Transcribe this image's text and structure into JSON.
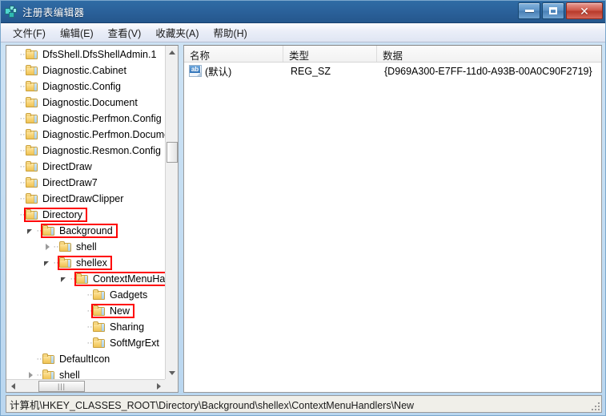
{
  "window": {
    "title": "注册表编辑器",
    "icon": "registry-editor-icon",
    "minimize_label": "最小化",
    "maximize_label": "最大化",
    "close_label": "关闭",
    "close_glyph": "✕"
  },
  "menubar": {
    "items": [
      {
        "label": "文件(F)",
        "name": "menu-file"
      },
      {
        "label": "编辑(E)",
        "name": "menu-edit"
      },
      {
        "label": "查看(V)",
        "name": "menu-view"
      },
      {
        "label": "收藏夹(A)",
        "name": "menu-favorites"
      },
      {
        "label": "帮助(H)",
        "name": "menu-help"
      }
    ]
  },
  "tree": {
    "rows": [
      {
        "label": "DfsShell.DfsShellAdmin.1",
        "indent": 0,
        "twisty": "none",
        "highlight": false
      },
      {
        "label": "Diagnostic.Cabinet",
        "indent": 0,
        "twisty": "none",
        "highlight": false
      },
      {
        "label": "Diagnostic.Config",
        "indent": 0,
        "twisty": "none",
        "highlight": false
      },
      {
        "label": "Diagnostic.Document",
        "indent": 0,
        "twisty": "none",
        "highlight": false
      },
      {
        "label": "Diagnostic.Perfmon.Config",
        "indent": 0,
        "twisty": "none",
        "highlight": false
      },
      {
        "label": "Diagnostic.Perfmon.Documen",
        "indent": 0,
        "twisty": "none",
        "highlight": false
      },
      {
        "label": "Diagnostic.Resmon.Config",
        "indent": 0,
        "twisty": "none",
        "highlight": false
      },
      {
        "label": "DirectDraw",
        "indent": 0,
        "twisty": "none",
        "highlight": false
      },
      {
        "label": "DirectDraw7",
        "indent": 0,
        "twisty": "none",
        "highlight": false
      },
      {
        "label": "DirectDrawClipper",
        "indent": 0,
        "twisty": "none",
        "highlight": false
      },
      {
        "label": "Directory",
        "indent": 0,
        "twisty": "none",
        "highlight": true
      },
      {
        "label": "Background",
        "indent": 1,
        "twisty": "expanded",
        "highlight": true
      },
      {
        "label": "shell",
        "indent": 2,
        "twisty": "collapsed",
        "highlight": false
      },
      {
        "label": "shellex",
        "indent": 2,
        "twisty": "expanded",
        "highlight": true
      },
      {
        "label": "ContextMenuHandlers",
        "indent": 3,
        "twisty": "expanded",
        "highlight": true
      },
      {
        "label": "Gadgets",
        "indent": 4,
        "twisty": "none",
        "highlight": false
      },
      {
        "label": "New",
        "indent": 4,
        "twisty": "none",
        "highlight": true
      },
      {
        "label": "Sharing",
        "indent": 4,
        "twisty": "none",
        "highlight": false
      },
      {
        "label": "SoftMgrExt",
        "indent": 4,
        "twisty": "none",
        "highlight": false
      },
      {
        "label": "DefaultIcon",
        "indent": 1,
        "twisty": "none",
        "highlight": false
      },
      {
        "label": "shell",
        "indent": 1,
        "twisty": "collapsed",
        "highlight": false
      }
    ],
    "scrollbar": {
      "up_arrow": "scroll-up-arrow",
      "down_arrow": "scroll-down-arrow",
      "left_arrow": "scroll-left-arrow",
      "right_arrow": "scroll-right-arrow",
      "h_grip": "|||"
    }
  },
  "list": {
    "columns": [
      "名称",
      "类型",
      "数据"
    ],
    "rows": [
      {
        "icon": "string-value-icon",
        "icon_text": "ab",
        "name": "(默认)",
        "type": "REG_SZ",
        "data": "{D969A300-E7FF-11d0-A93B-00A0C90F2719}"
      }
    ]
  },
  "statusbar": {
    "path": "计算机\\HKEY_CLASSES_ROOT\\Directory\\Background\\shellex\\ContextMenuHandlers\\New"
  },
  "colors": {
    "titlebar": "#2a6099",
    "highlight_box": "#ff0000",
    "folder": "#f7d272",
    "frame": "#b9d6ef"
  }
}
